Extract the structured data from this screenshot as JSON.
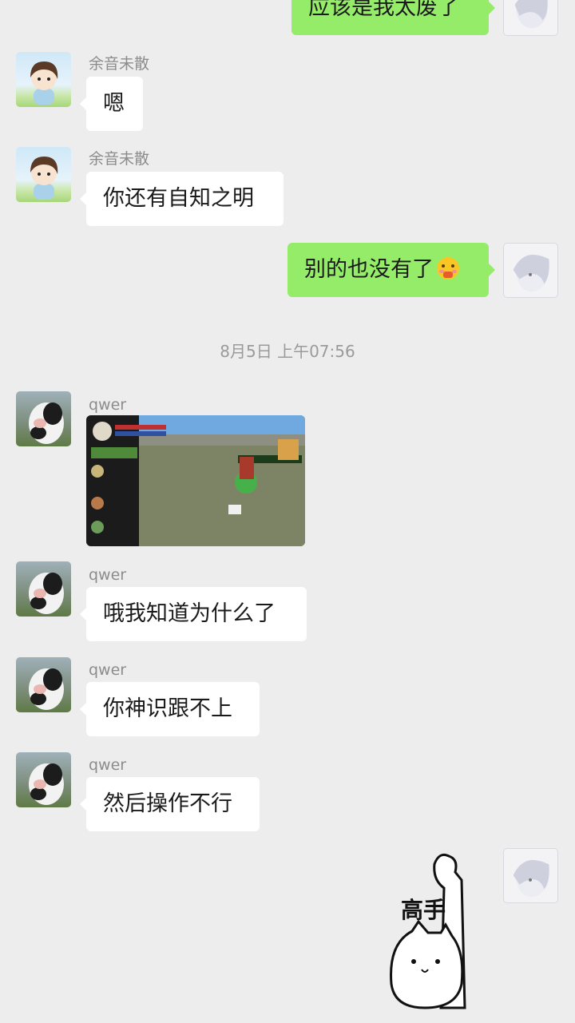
{
  "messages": {
    "m0": {
      "text": "应该是我太废了"
    },
    "m1": {
      "sender": "余音未散",
      "text": "嗯"
    },
    "m2": {
      "sender": "余音未散",
      "text": "你还有自知之明"
    },
    "m3": {
      "text": "别的也没有了",
      "emoji": "face-with-hand-over-mouth"
    },
    "timestamp": "8月5日 上午07:56",
    "m4": {
      "sender": "qwer",
      "type": "image",
      "content": "game-screenshot"
    },
    "m5": {
      "sender": "qwer",
      "text": "哦我知道为什么了"
    },
    "m6": {
      "sender": "qwer",
      "text": "你神识跟不上"
    },
    "m7": {
      "sender": "qwer",
      "text": "然后操作不行"
    },
    "m8": {
      "type": "sticker",
      "text": "高手",
      "content": "cat-flexing-arm"
    }
  },
  "colors": {
    "background": "#ededed",
    "self_bubble": "#95ec69",
    "other_bubble": "#ffffff"
  },
  "icons": [
    "boy-avatar-icon",
    "cow-avatar-icon",
    "anime-avatar-icon",
    "blush-emoji-icon",
    "cat-sticker-icon"
  ]
}
